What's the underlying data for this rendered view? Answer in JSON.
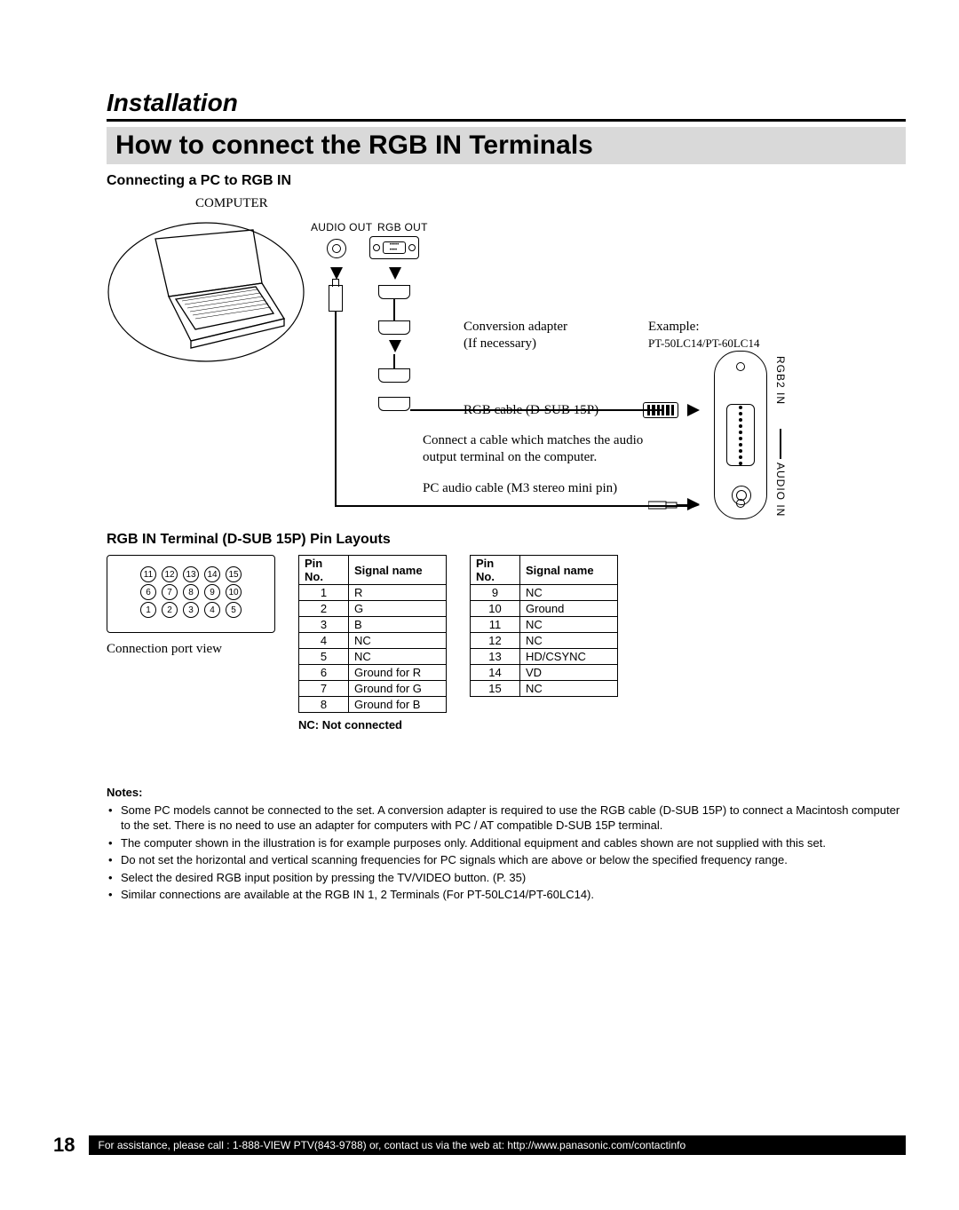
{
  "section_heading": "Installation",
  "title": "How to connect the RGB IN Terminals",
  "subhead_connect": "Connecting a PC to RGB IN",
  "diagram": {
    "computer_label": "COMPUTER",
    "audio_out": "AUDIO OUT",
    "rgb_out": "RGB OUT",
    "conversion_adapter_l1": "Conversion adapter",
    "conversion_adapter_l2": "(If necessary)",
    "example": "Example:",
    "example_models": "PT-50LC14/PT-60LC14",
    "rgb_cable": "RGB cable (D-SUB 15P)",
    "connect_audio": "Connect a cable which matches the audio output terminal on the computer.",
    "pc_audio_cable": "PC audio cable (M3 stereo mini pin)",
    "rgb2_in": "RGB2 IN",
    "audio_in": "AUDIO IN"
  },
  "subhead_pins": "RGB IN Terminal (D-SUB 15P) Pin Layouts",
  "connector_caption": "Connection port view",
  "pin_header_no": "Pin No.",
  "pin_header_name": "Signal name",
  "pins_left": [
    {
      "no": "1",
      "name": "R"
    },
    {
      "no": "2",
      "name": "G"
    },
    {
      "no": "3",
      "name": "B"
    },
    {
      "no": "4",
      "name": "NC"
    },
    {
      "no": "5",
      "name": "NC"
    },
    {
      "no": "6",
      "name": "Ground for R"
    },
    {
      "no": "7",
      "name": "Ground for G"
    },
    {
      "no": "8",
      "name": "Ground for B"
    }
  ],
  "pins_right": [
    {
      "no": "9",
      "name": "NC"
    },
    {
      "no": "10",
      "name": "Ground"
    },
    {
      "no": "11",
      "name": "NC"
    },
    {
      "no": "12",
      "name": "NC"
    },
    {
      "no": "13",
      "name": "HD/CSYNC"
    },
    {
      "no": "14",
      "name": "VD"
    },
    {
      "no": "15",
      "name": "NC"
    }
  ],
  "nc_note": "NC: Not connected",
  "notes_title": "Notes:",
  "notes": [
    "Some PC models cannot be connected to the set. A conversion adapter is required to use the RGB cable (D-SUB 15P) to connect a Macintosh computer to the set. There is no need to use an adapter for computers with PC / AT compatible D-SUB 15P terminal.",
    "The computer shown in the illustration is for example purposes only. Additional equipment and cables shown are not supplied with this set.",
    "Do not set the horizontal and vertical scanning frequencies for PC signals which are above or below the specified frequency range.",
    "Select the desired RGB input position by pressing the TV/VIDEO button. (P. 35)",
    "Similar connections are available at the RGB IN 1, 2 Terminals (For PT-50LC14/PT-60LC14)."
  ],
  "page_number": "18",
  "footer_text": "For assistance, please call : 1-888-VIEW PTV(843-9788) or, contact us via the web at: http://www.panasonic.com/contactinfo",
  "connector_pins_row1": [
    "11",
    "12",
    "13",
    "14",
    "15"
  ],
  "connector_pins_row2": [
    "6",
    "7",
    "8",
    "9",
    "10"
  ],
  "connector_pins_row3": [
    "1",
    "2",
    "3",
    "4",
    "5"
  ]
}
